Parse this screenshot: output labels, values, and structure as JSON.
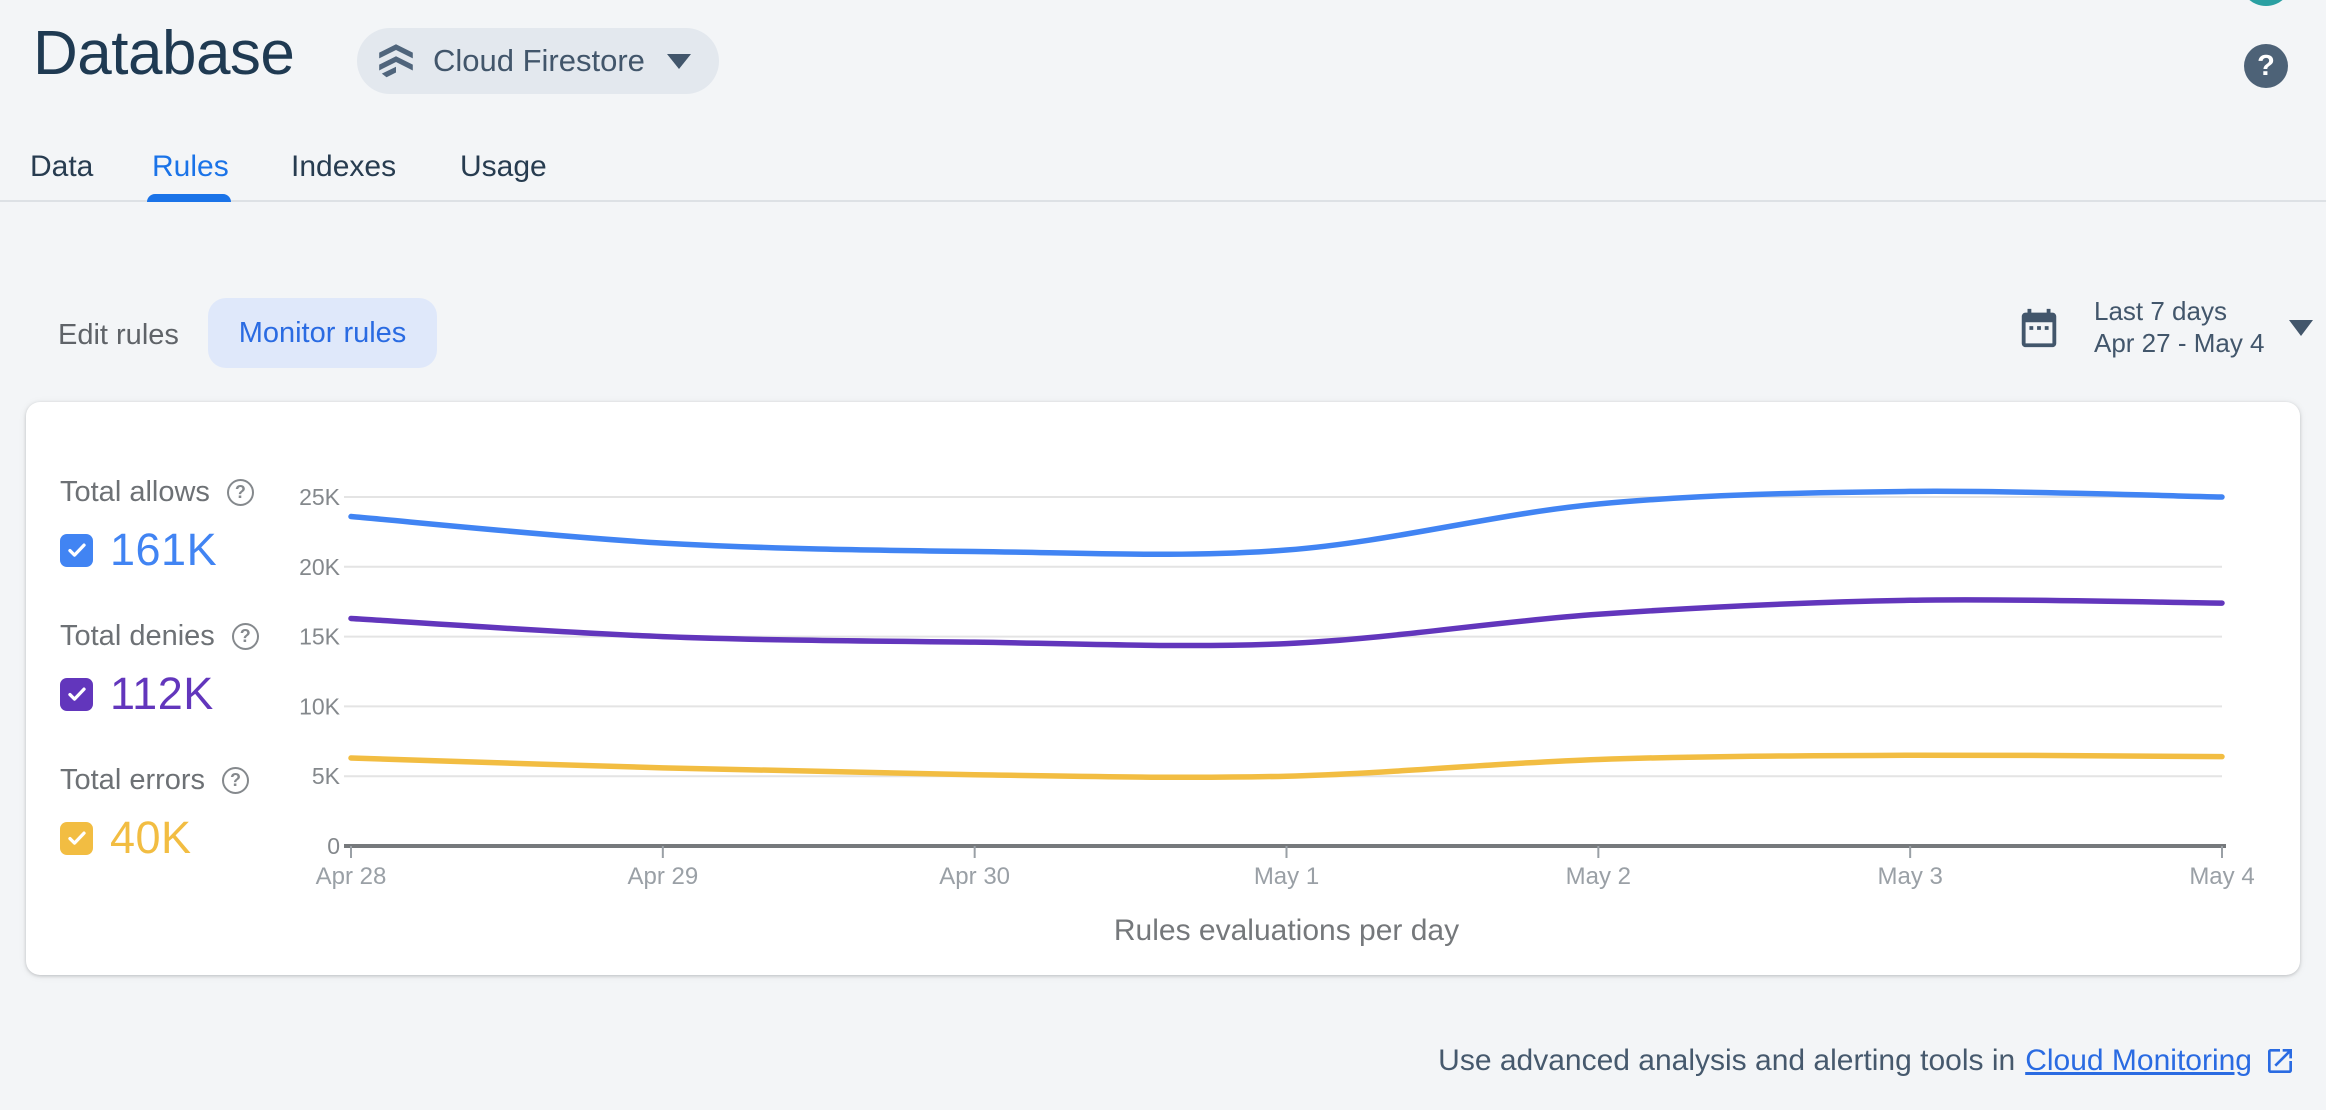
{
  "header": {
    "title": "Database",
    "product_selector": {
      "label": "Cloud Firestore"
    },
    "help_glyph": "?"
  },
  "tabs": {
    "items": [
      {
        "label": "Data",
        "active": false
      },
      {
        "label": "Rules",
        "active": true
      },
      {
        "label": "Indexes",
        "active": false
      },
      {
        "label": "Usage",
        "active": false
      }
    ]
  },
  "controls": {
    "edit_rules_label": "Edit rules",
    "monitor_rules_label": "Monitor rules",
    "date_range": {
      "line1": "Last 7 days",
      "line2": "Apr 27 - May 4"
    }
  },
  "chart_data": {
    "type": "line",
    "title": "Rules evaluations per day",
    "x": [
      "Apr 28",
      "Apr 29",
      "Apr 30",
      "May 1",
      "May 2",
      "May 3",
      "May 4"
    ],
    "series": [
      {
        "name": "Total allows",
        "total_label": "161K",
        "color": "#4184f3",
        "values": [
          23600,
          21700,
          21100,
          21200,
          24500,
          25400,
          25000
        ]
      },
      {
        "name": "Total denies",
        "total_label": "112K",
        "color": "#6236bc",
        "values": [
          16300,
          15000,
          14600,
          14500,
          16600,
          17600,
          17400
        ]
      },
      {
        "name": "Total errors",
        "total_label": "40K",
        "color": "#f2bd42",
        "values": [
          6300,
          5600,
          5100,
          5000,
          6200,
          6500,
          6400
        ]
      }
    ],
    "y_ticks": [
      "0",
      "5K",
      "10K",
      "15K",
      "20K",
      "25K"
    ],
    "y_tick_step": 5000,
    "ylim": [
      0,
      25000
    ],
    "grid": true,
    "legend_position": "left",
    "help_glyph": "?"
  },
  "footer": {
    "text_prefix": "Use advanced analysis and alerting tools in",
    "link_label": "Cloud Monitoring"
  },
  "colors": {
    "accent_blue": "#1a73e8",
    "avatar_teal": "#2aa0a2",
    "gridline": "#e4e4e4",
    "axis_baseline": "#76797c",
    "axis_tick": "#9aa0a6",
    "y_label": "#84888c",
    "x_label": "#9aa0a6"
  }
}
